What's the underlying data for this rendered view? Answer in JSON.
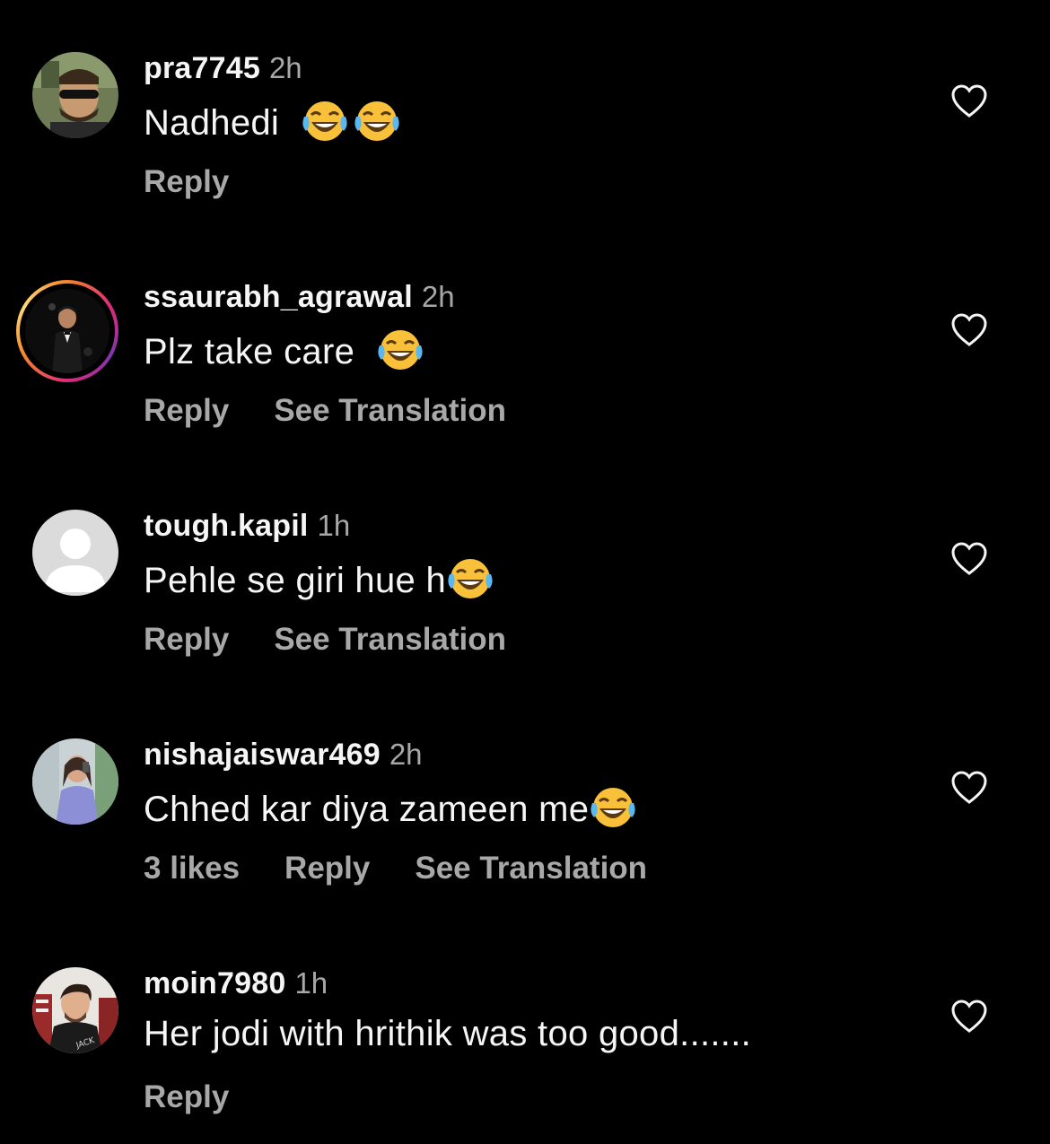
{
  "comments": [
    {
      "username": "pra7745",
      "time": "2h",
      "text": "Nadhedi",
      "emojis": [
        "face-with-tears-of-joy",
        "face-with-tears-of-joy"
      ],
      "reply_label": "Reply"
    },
    {
      "username": "ssaurabh_agrawal",
      "time": "2h",
      "text": "Plz take care",
      "emojis": [
        "face-with-tears-of-joy"
      ],
      "reply_label": "Reply",
      "translation_label": "See Translation"
    },
    {
      "username": "tough.kapil",
      "time": "1h",
      "text": "Pehle se giri hue h",
      "emojis": [
        "face-with-tears-of-joy"
      ],
      "reply_label": "Reply",
      "translation_label": "See Translation"
    },
    {
      "username": "nishajaiswar469",
      "time": "2h",
      "text": "Chhed kar diya zameen me",
      "emojis": [
        "face-with-tears-of-joy"
      ],
      "likes_label": "3 likes",
      "reply_label": "Reply",
      "translation_label": "See Translation"
    },
    {
      "username": "moin7980",
      "time": "1h",
      "text": "Her jodi with hrithik was too good.......",
      "reply_label": "Reply"
    }
  ],
  "colors": {
    "background": "#000000",
    "primary_text": "#f5f5f5",
    "secondary_text": "#a8a8a8",
    "story_ring_start": "#f58529",
    "story_ring_end": "#dd2a7b"
  },
  "icons": {
    "like": "heart-outline-icon",
    "emoji": "face-with-tears-of-joy"
  }
}
